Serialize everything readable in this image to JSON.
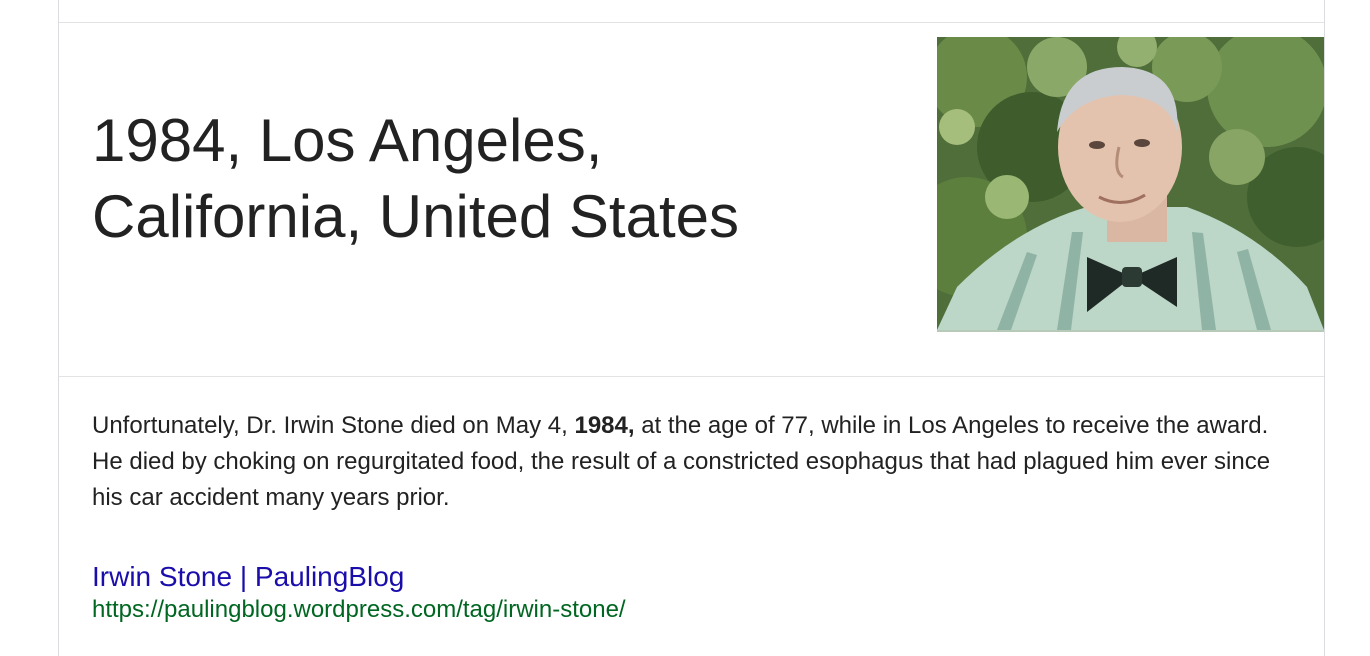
{
  "answer": {
    "title_line1": "1984, Los Angeles,",
    "title_line2": "California, United States"
  },
  "image": {
    "alt": "Irwin Stone"
  },
  "snippet": {
    "before": "Unfortunately, Dr. Irwin Stone died on May 4, ",
    "bold": "1984,",
    "after": " at the age of 77, while in Los Angeles to receive the award. He died by choking on regurgitated food, the result of a constricted esophagus that had plagued him ever since his car accident many years prior."
  },
  "result": {
    "title": "Irwin Stone | PaulingBlog",
    "url": "https://paulingblog.wordpress.com/tag/irwin-stone/"
  },
  "colors": {
    "link": "#1a0dab",
    "url": "#006621",
    "text": "#222222",
    "border": "#dadce0"
  }
}
